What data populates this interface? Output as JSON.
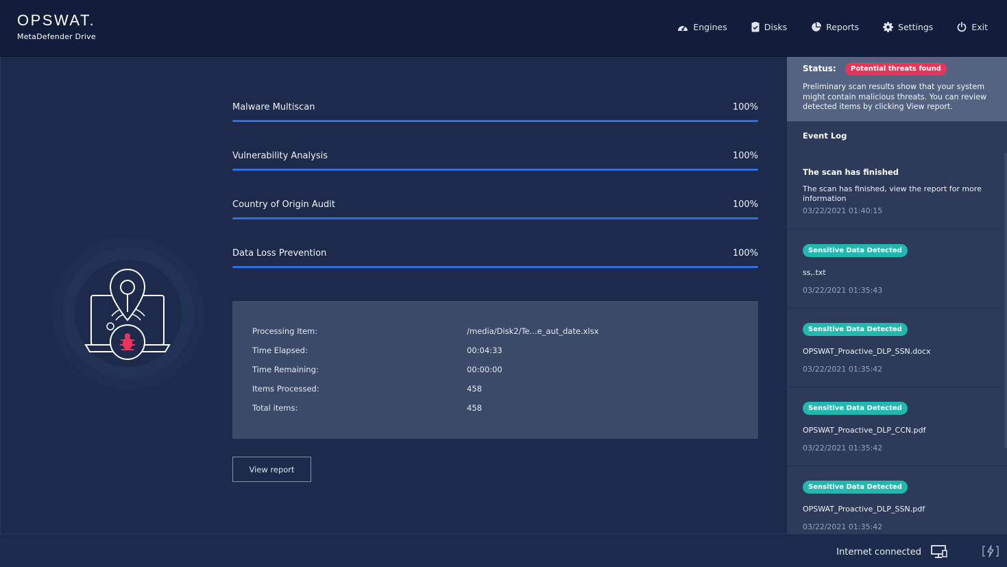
{
  "app": {
    "brand": "OPSWAT.",
    "product": "MetaDefender Drive"
  },
  "nav": {
    "items": [
      {
        "label": "Engines",
        "icon": "speedometer-icon"
      },
      {
        "label": "Disks",
        "icon": "disk-check-icon"
      },
      {
        "label": "Reports",
        "icon": "pie-chart-icon"
      },
      {
        "label": "Settings",
        "icon": "gear-icon"
      },
      {
        "label": "Exit",
        "icon": "power-icon"
      }
    ]
  },
  "scan": {
    "progress": [
      {
        "label": "Malware Multiscan",
        "value_text": "100%",
        "fraction": 1.0
      },
      {
        "label": "Vulnerability Analysis",
        "value_text": "100%",
        "fraction": 1.0
      },
      {
        "label": "Country of Origin Audit",
        "value_text": "100%",
        "fraction": 1.0
      },
      {
        "label": "Data Loss Prevention",
        "value_text": "100%",
        "fraction": 1.0
      }
    ],
    "details": [
      {
        "key": "Processing Item:",
        "value": "/media/Disk2/Te...e_aut_date.xlsx"
      },
      {
        "key": "Time Elapsed:",
        "value": "00:04:33"
      },
      {
        "key": "Time Remaining:",
        "value": "00:00:00"
      },
      {
        "key": "Items Processed:",
        "value": "458"
      },
      {
        "key": "Total items:",
        "value": "458"
      }
    ],
    "view_report_label": "View report"
  },
  "status": {
    "title": "Status:",
    "badge": "Potential threats found",
    "text": "Preliminary scan results show that your system might contain malicious threats. You can review detected items by clicking View report."
  },
  "event_log": {
    "title": "Event Log",
    "first": {
      "heading": "The scan has finished",
      "body": "The scan has finished, view the report for more information",
      "time": "03/22/2021 01:40:15"
    },
    "items": [
      {
        "badge": "Sensitive Data Detected",
        "file": "ss,.txt",
        "time": "03/22/2021 01:35:43"
      },
      {
        "badge": "Sensitive Data Detected",
        "file": "OPSWAT_Proactive_DLP_SSN.docx",
        "time": "03/22/2021 01:35:42"
      },
      {
        "badge": "Sensitive Data Detected",
        "file": "OPSWAT_Proactive_DLP_CCN.pdf",
        "time": "03/22/2021 01:35:42"
      },
      {
        "badge": "Sensitive Data Detected",
        "file": "OPSWAT_Proactive_DLP_SSN.pdf",
        "time": "03/22/2021 01:35:42"
      }
    ]
  },
  "footer": {
    "connection": "Internet connected"
  },
  "colors": {
    "accent_blue": "#2f6fe4",
    "threat_red": "#e8355c",
    "dlp_teal": "#21b8b0",
    "header_bg": "#111d3a"
  }
}
